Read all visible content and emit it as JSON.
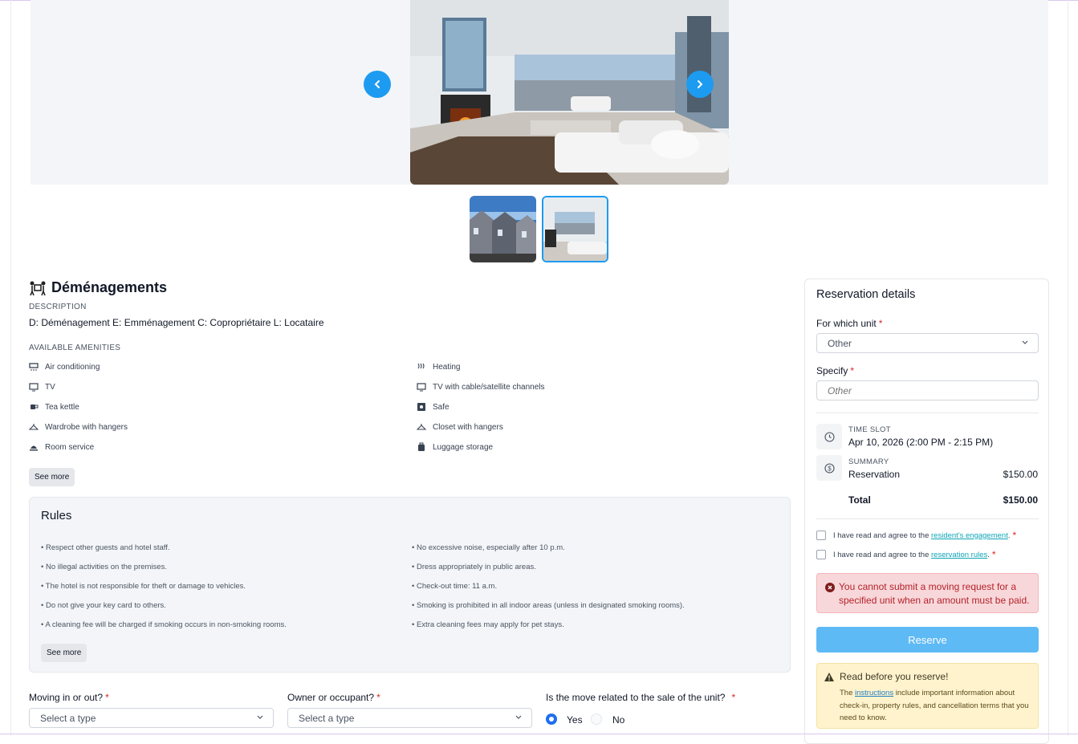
{
  "gallery": {
    "prev_label": "Previous image",
    "next_label": "Next image"
  },
  "service": {
    "title": "Déménagements",
    "description_label": "DESCRIPTION",
    "description": "D: Déménagement E: Emménagement C: Copropriétaire L: Locataire",
    "amenities_label": "AVAILABLE AMENITIES",
    "amenities": [
      {
        "label": "Air conditioning",
        "icon": "air-conditioning-icon"
      },
      {
        "label": "Heating",
        "icon": "heating-icon"
      },
      {
        "label": "TV",
        "icon": "tv-icon"
      },
      {
        "label": "TV with cable/satellite channels",
        "icon": "tv-icon"
      },
      {
        "label": "Tea kettle",
        "icon": "tea-kettle-icon"
      },
      {
        "label": "Safe",
        "icon": "safe-icon"
      },
      {
        "label": "Wardrobe with hangers",
        "icon": "hanger-icon"
      },
      {
        "label": "Closet with hangers",
        "icon": "hanger-icon"
      },
      {
        "label": "Room service",
        "icon": "room-service-icon"
      },
      {
        "label": "Luggage storage",
        "icon": "luggage-icon"
      }
    ],
    "see_more": "See more"
  },
  "rules": {
    "title": "Rules",
    "items": [
      "• Respect other guests and hotel staff.",
      "• No excessive noise, especially after 10 p.m.",
      "• No illegal activities on the premises.",
      "• Dress appropriately in public areas.",
      "• The hotel is not responsible for theft or damage to vehicles.",
      "• Check-out time: 11 a.m.",
      "• Do not give your key card to others.",
      "• Smoking is prohibited in all indoor areas (unless in designated smoking rooms).",
      "• A cleaning fee will be charged if smoking occurs in non-smoking rooms.",
      "• Extra cleaning fees may apply for pet stays."
    ],
    "see_more": "See more"
  },
  "form": {
    "moving_label": "Moving in or out?",
    "moving_placeholder": "Select a type",
    "owner_label": "Owner or occupant?",
    "owner_placeholder": "Select a type",
    "sale_label": "Is the move related to the sale of the unit?",
    "yes": "Yes",
    "no": "No"
  },
  "reservation": {
    "title": "Reservation details",
    "unit_label": "For which unit",
    "unit_value": "Other",
    "specify_label": "Specify",
    "specify_placeholder": "Other",
    "time_slot_label": "TIME SLOT",
    "time_slot_value": "Apr 10, 2026 (2:00 PM - 2:15 PM)",
    "summary_label": "SUMMARY",
    "reservation_line": "Reservation",
    "reservation_amount": "$150.00",
    "total_label": "Total",
    "total_amount": "$150.00",
    "agree_prefix": "I have read and agree to the",
    "engagement_link": "resident's engagement",
    "rules_link": "reservation rules",
    "error": "You cannot submit a moving request for a specified unit when an amount must be paid.",
    "reserve_button": "Reserve",
    "warn_title": "Read before you reserve!",
    "warn_prefix": "The",
    "warn_link": "instructions",
    "warn_text": "include important information about check-in, property rules, and cancellation terms that you need to know."
  },
  "colors": {
    "accent": "#1d9bf0",
    "error": "#b4232a",
    "required": "#dc2626"
  }
}
